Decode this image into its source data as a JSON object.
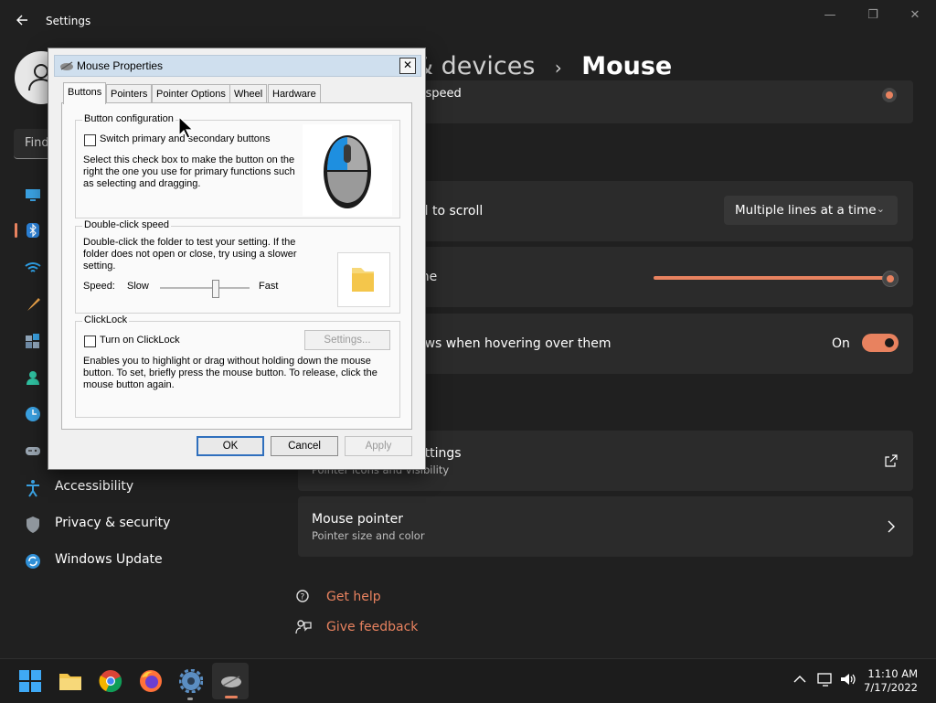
{
  "settings": {
    "title": "Settings",
    "search_placeholder": "Find",
    "breadcrumb": {
      "parent": "& devices",
      "separator": "›",
      "current": "Mouse"
    },
    "nav": {
      "accessibility": "Accessibility",
      "privacy": "Privacy & security",
      "update": "Windows Update"
    },
    "rows": {
      "speed_partial": "r speed",
      "scroll_label": "el to scroll",
      "scroll_value": "Multiple lines at a time",
      "lines_label": "me",
      "lines_value_fraction": 1.0,
      "hover_label": "ows when hovering over them",
      "hover_state": "On",
      "additional_title": "ettings",
      "additional_sub": "Pointer icons and visibility",
      "pointer_title": "Mouse pointer",
      "pointer_sub": "Pointer size and color"
    },
    "links": {
      "help": "Get help",
      "feedback": "Give feedback"
    },
    "colors": {
      "accent": "#e8825f",
      "background": "#202020",
      "card": "#2b2b2b"
    }
  },
  "dialog": {
    "title": "Mouse Properties",
    "tabs": [
      "Buttons",
      "Pointers",
      "Pointer Options",
      "Wheel",
      "Hardware"
    ],
    "active_tab": "Buttons",
    "button_config": {
      "legend": "Button configuration",
      "checkbox_label": "Switch primary and secondary buttons",
      "checked": false,
      "description": [
        "Select this check box to make the button on the",
        "right the one you use for primary functions such",
        "as selecting and dragging."
      ]
    },
    "double_click": {
      "legend": "Double-click speed",
      "description": [
        "Double-click the folder to test your setting. If the",
        "folder does not open or close, try using a slower",
        "setting."
      ],
      "speed_label": "Speed:",
      "slow": "Slow",
      "fast": "Fast",
      "speed_fraction": 0.62
    },
    "clicklock": {
      "legend": "ClickLock",
      "checkbox_label": "Turn on ClickLock",
      "checked": false,
      "settings_button": "Settings...",
      "description": [
        "Enables you to highlight or drag without holding down the mouse",
        "button. To set, briefly press the mouse button. To release, click the",
        "mouse button again."
      ]
    },
    "buttons": {
      "ok": "OK",
      "cancel": "Cancel",
      "apply": "Apply"
    }
  },
  "taskbar": {
    "apps": [
      "start-icon",
      "file-explorer-icon",
      "chrome-icon",
      "firefox-icon",
      "settings-icon",
      "mouse-properties-icon"
    ],
    "time": "11:10 AM",
    "date": "7/17/2022"
  }
}
